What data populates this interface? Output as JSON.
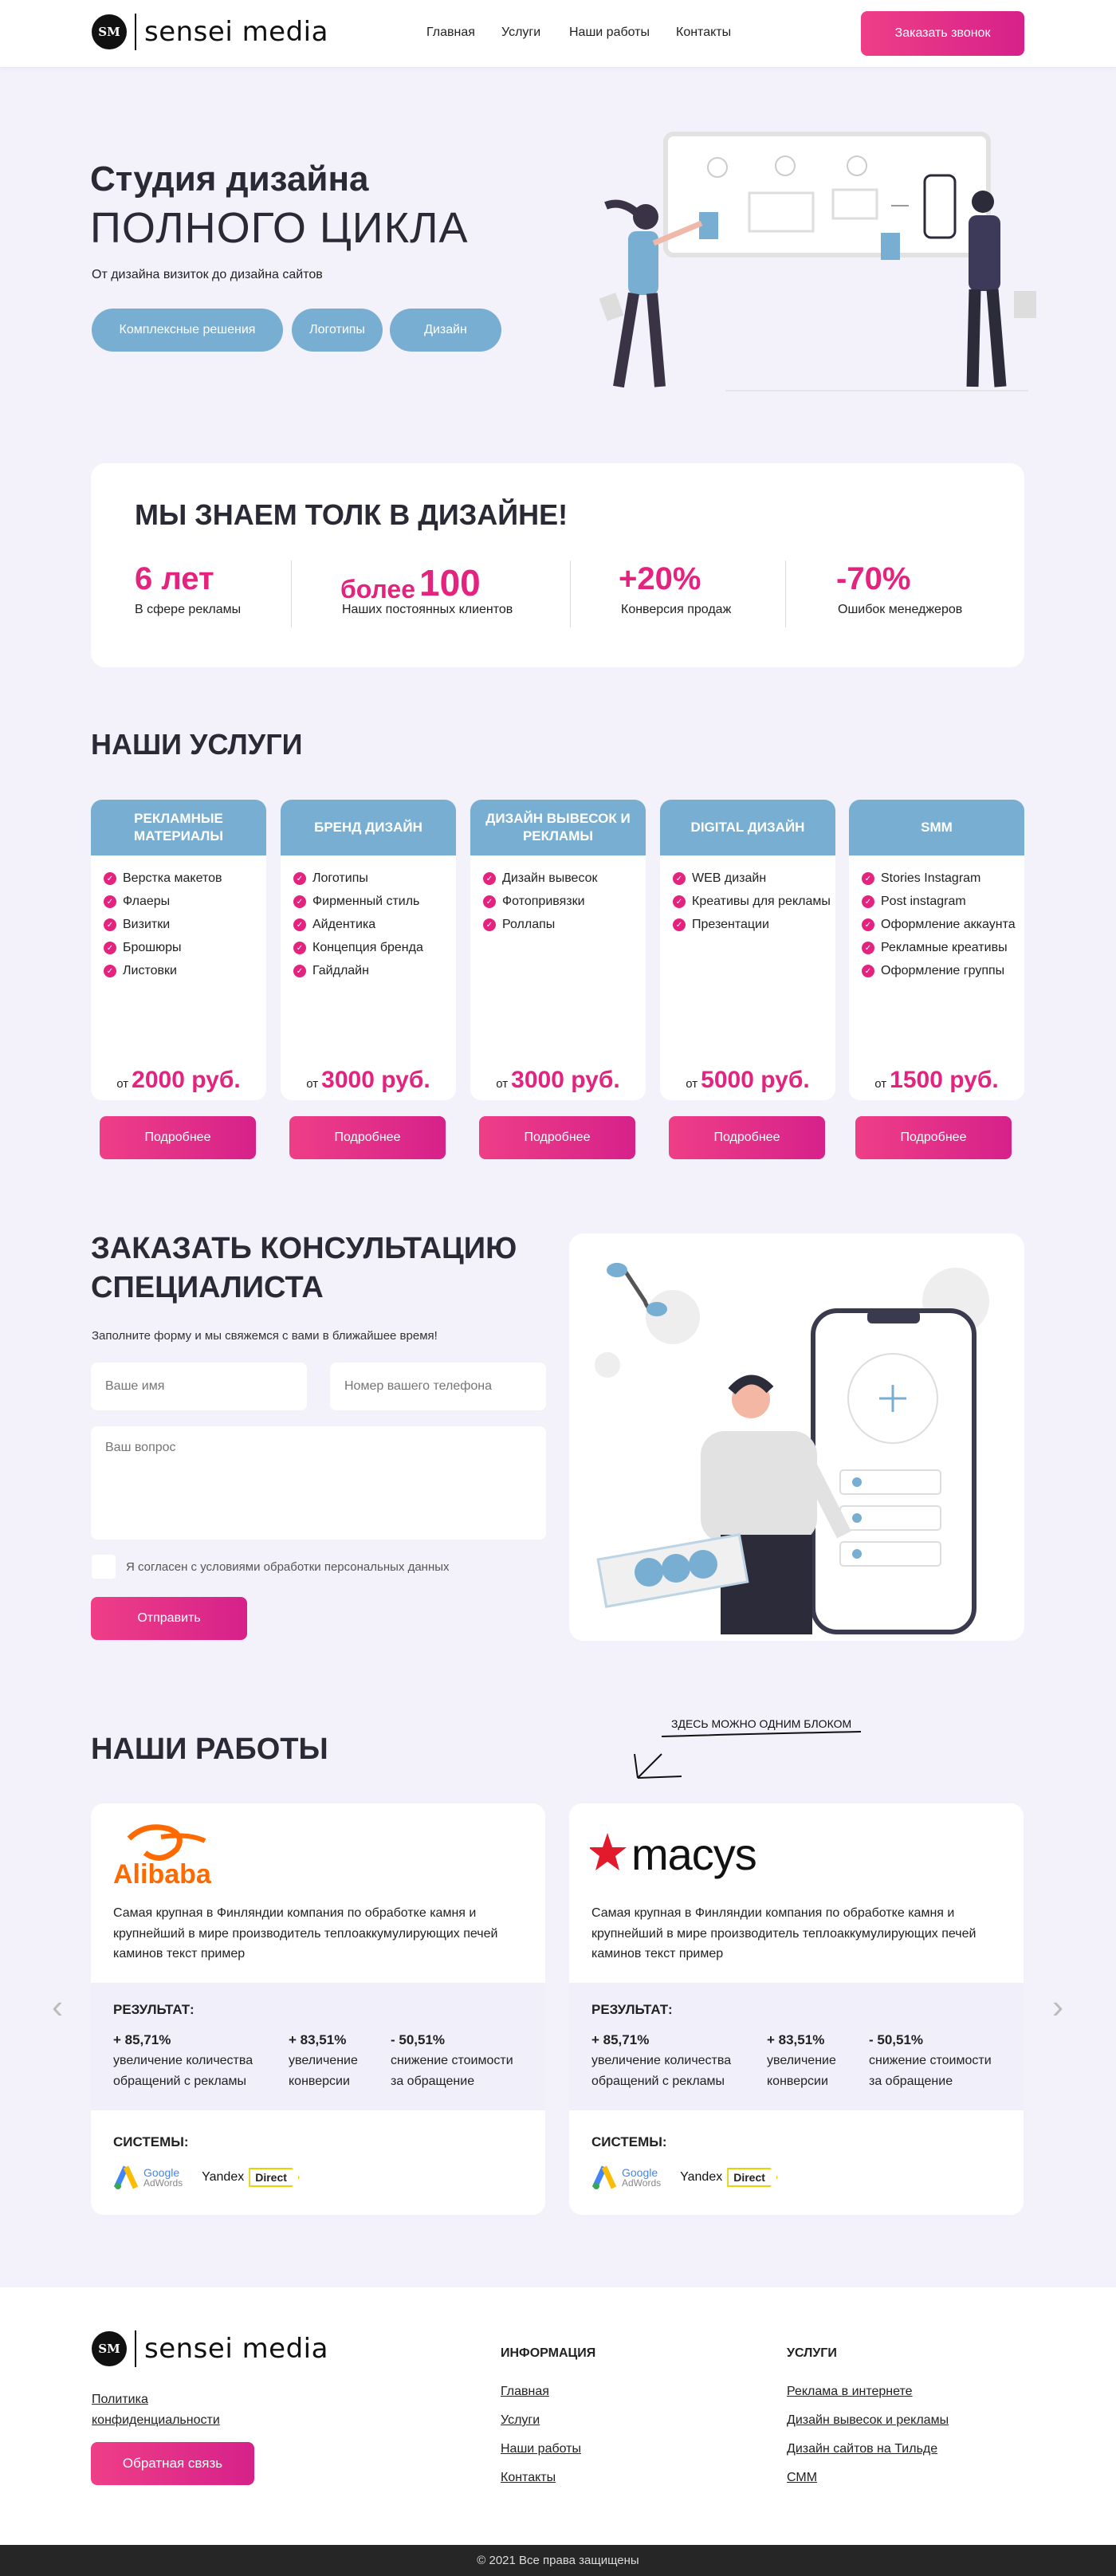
{
  "brand": {
    "badge": "SM",
    "name": "sensei media"
  },
  "nav": {
    "items": [
      "Главная",
      "Услуги",
      "Наши работы",
      "Контакты"
    ],
    "cta": "Заказать звонок"
  },
  "hero": {
    "title1": "Студия дизайна",
    "title2": "ПОЛНОГО ЦИКЛА",
    "subtitle": "От дизайна визиток до дизайна сайтов",
    "pills": [
      "Комплексные решения",
      "Логотипы",
      "Дизайн"
    ]
  },
  "stats": {
    "title": "МЫ ЗНАЕМ ТОЛК В ДИЗАЙНЕ!",
    "items": [
      {
        "prefix": "",
        "value": "6 лет",
        "label": "В сфере рекламы"
      },
      {
        "prefix": "более",
        "value": "100",
        "label": "Наших постоянных клиентов"
      },
      {
        "prefix": "",
        "value": "+20%",
        "label": "Конверсия продаж"
      },
      {
        "prefix": "",
        "value": "-70%",
        "label": "Ошибок менеджеров"
      }
    ]
  },
  "services": {
    "title": "НАШИ УСЛУГИ",
    "more": "Подробнее",
    "from": "от",
    "items": [
      {
        "title": "РЕКЛАМНЫЕ МАТЕРИАЛЫ",
        "list": [
          "Верстка макетов",
          "Флаеры",
          "Визитки",
          "Брошюры",
          "Листовки"
        ],
        "price": "2000 руб."
      },
      {
        "title": "БРЕНД ДИЗАЙН",
        "list": [
          "Логотипы",
          "Фирменный стиль",
          "Айдентика",
          "Концепция бренда",
          "Гайдлайн"
        ],
        "price": "3000 руб."
      },
      {
        "title": "ДИЗАЙН ВЫВЕСОК И РЕКЛАМЫ",
        "list": [
          "Дизайн вывесок",
          "Фотопривязки",
          "Роллапы"
        ],
        "price": "3000 руб."
      },
      {
        "title": "DIGITAL ДИЗАЙН",
        "list": [
          "WEB дизайн",
          "Креативы для рекламы",
          "Презентации"
        ],
        "price": "5000 руб."
      },
      {
        "title": "SMM",
        "list": [
          "Stories Instagram",
          "Post instagram",
          "Оформление аккаунта",
          "Рекламные креативы",
          "Оформление группы"
        ],
        "price": "1500 руб."
      }
    ]
  },
  "consult": {
    "title1": "ЗАКАЗАТЬ КОНСУЛЬТАЦИЮ",
    "title2": "СПЕЦИАЛИСТА",
    "subtitle": "Заполните форму и мы свяжемся с вами в ближайшее время!",
    "name_ph": "Ваше имя",
    "phone_ph": "Номер вашего телефона",
    "question_ph": "Ваш вопрос",
    "agree": "Я согласен с условиями обработки персональных данных",
    "submit": "Отправить"
  },
  "works": {
    "title": "НАШИ РАБОТЫ",
    "note": "ЗДЕСЬ МОЖНО ОДНИМ БЛОКОМ",
    "result_label": "РЕЗУЛЬТАТ:",
    "systems_label": "СИСТЕМЫ:",
    "cards": [
      {
        "logo": "Alibaba",
        "desc": "Самая крупная в Финляндии компания по обработке камня и крупнейший в мире производитель теплоаккумулирующих печей каминов текст пример",
        "results": [
          {
            "value": "+ 85,71%",
            "label": "увеличение количества обращений с рекламы"
          },
          {
            "value": "+ 83,51%",
            "label": "увеличение конверсии"
          },
          {
            "value": "- 50,51%",
            "label": "снижение стоимости за обращение"
          }
        ]
      },
      {
        "logo": "macys",
        "desc": "Самая крупная в Финляндии компания по обработке камня и крупнейший в мире производитель теплоаккумулирующих печей каминов текст пример",
        "results": [
          {
            "value": "+ 85,71%",
            "label": "увеличение количества обращений с рекламы"
          },
          {
            "value": "+ 83,51%",
            "label": "увеличение конверсии"
          },
          {
            "value": "- 50,51%",
            "label": "снижение стоимости за обращение"
          }
        ]
      }
    ],
    "systems": {
      "google": "Google",
      "adwords": "AdWords",
      "yandex": "Yandex",
      "direct": "Direct"
    }
  },
  "footer": {
    "privacy": "Политика конфиденциальности",
    "feedback": "Обратная связь",
    "info_title": "ИНФОРМАЦИЯ",
    "info_links": [
      "Главная",
      "Услуги",
      "Наши работы",
      "Контакты"
    ],
    "services_title": "УСЛУГИ",
    "service_links": [
      "Реклама в интернете",
      "Дизайн вывесок и рекламы",
      "Дизайн сайтов на Тильде",
      "СММ"
    ],
    "copyright": "© 2021 Все права защищены"
  },
  "colors": {
    "accent": "#e4237e",
    "blue": "#78aed1",
    "bg": "#f3f2fb",
    "dark": "#262626"
  }
}
